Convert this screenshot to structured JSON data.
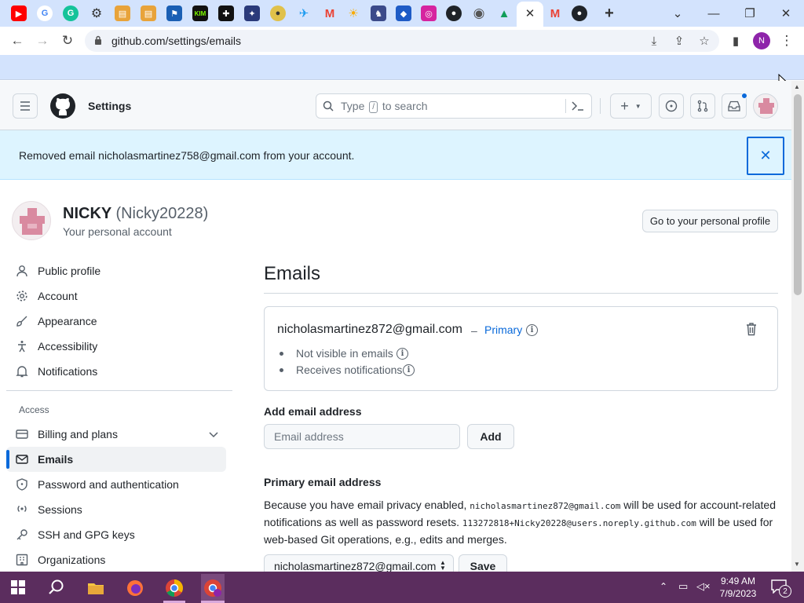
{
  "browser": {
    "url": "github.com/settings/emails",
    "profile_initial": "N",
    "tab_icons": [
      "youtube-icon",
      "google-icon",
      "grammarly-icon",
      "settings-icon",
      "folder-icon",
      "folder-icon",
      "bookmark-icon",
      "kim-icon",
      "puzzle-icon",
      "image-icon",
      "coin-icon",
      "twitter-icon",
      "gmail-icon",
      "bulb-icon",
      "game-icon",
      "sonic-icon",
      "instagram-icon",
      "github-icon",
      "chrome-icon",
      "drive-icon",
      "close-icon",
      "gmail-icon",
      "github-icon"
    ],
    "tab_labels": {
      "kim": "KIM"
    }
  },
  "header": {
    "title": "Settings",
    "search_placeholder_pre": "Type",
    "search_key": "/",
    "search_placeholder_post": "to search"
  },
  "flash": {
    "message": "Removed email nicholasmartinez758@gmail.com from your account."
  },
  "user": {
    "name": "NICKY",
    "login": "(Nicky20228)",
    "subtitle": "Your personal account",
    "profile_button": "Go to your personal profile"
  },
  "sidebar": {
    "items": [
      {
        "label": "Public profile"
      },
      {
        "label": "Account"
      },
      {
        "label": "Appearance"
      },
      {
        "label": "Accessibility"
      },
      {
        "label": "Notifications"
      }
    ],
    "access_heading": "Access",
    "access_items": [
      {
        "label": "Billing and plans"
      },
      {
        "label": "Emails"
      },
      {
        "label": "Password and authentication"
      },
      {
        "label": "Sessions"
      },
      {
        "label": "SSH and GPG keys"
      },
      {
        "label": "Organizations"
      }
    ]
  },
  "main": {
    "title": "Emails",
    "email": {
      "address": "nicholasmartinez872@gmail.com",
      "separator": "–",
      "badge": "Primary",
      "bullets": [
        "Not visible in emails",
        "Receives notifications"
      ]
    },
    "add": {
      "label": "Add email address",
      "placeholder": "Email address",
      "button": "Add"
    },
    "primary_section": {
      "label": "Primary email address",
      "text_1": "Because you have email privacy enabled,",
      "code_1": "nicholasmartinez872@gmail.com",
      "text_2": "will be used for account-related notifications as well as password resets.",
      "code_2": "113272818+Nicky20228@users.noreply.github.com",
      "text_3": "will be used for web-based Git operations, e.g., edits and merges.",
      "selected": "nicholasmartinez872@gmail.com",
      "save_button": "Save"
    }
  },
  "taskbar": {
    "time": "9:49 AM",
    "date": "7/9/2023",
    "notification_count": "2"
  },
  "colors": {
    "accent": "#0969da",
    "flash_bg": "#ddf4ff",
    "taskbar": "#5b2d5e",
    "tabstrip": "#d3e3fd"
  }
}
